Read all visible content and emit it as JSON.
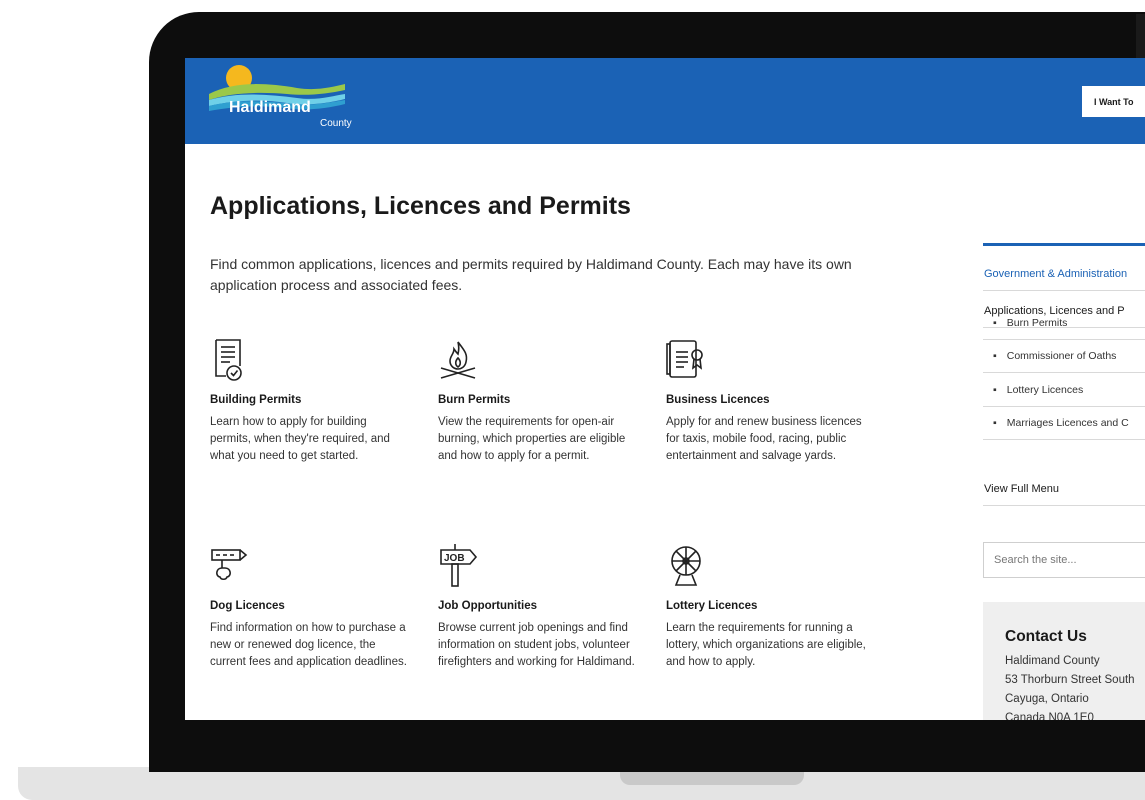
{
  "site": {
    "name": "Haldimand",
    "sub": "County",
    "header_button": "I Want To"
  },
  "page": {
    "title": "Applications, Licences and Permits",
    "intro": "Find common applications, licences and permits required by Haldimand County. Each may have its own application process and associated fees."
  },
  "cards": [
    {
      "icon": "document-certificate-icon",
      "title": "Building Permits",
      "desc": "Learn how to apply for building permits, when they're required, and what you need to get started."
    },
    {
      "icon": "campfire-icon",
      "title": "Burn Permits",
      "desc": "View the requirements for open-air burning, which properties are eligible and how to apply for a permit."
    },
    {
      "icon": "licence-document-icon",
      "title": "Business Licences",
      "desc": "Apply for and renew business licences for taxis, mobile food, racing, public entertainment and salvage yards."
    },
    {
      "icon": "dog-tag-icon",
      "title": "Dog Licences",
      "desc": "Find information on how to purchase a new or renewed dog licence, the current fees and application deadlines."
    },
    {
      "icon": "job-sign-icon",
      "title": "Job Opportunities",
      "desc": "Browse current job openings and find information on student jobs, volunteer firefighters and working for Haldimand."
    },
    {
      "icon": "lottery-wheel-icon",
      "title": "Lottery Licences",
      "desc": "Learn the requirements for running a lottery, which organizations are eligible, and how to apply."
    }
  ],
  "sidebar": {
    "parent": "Government & Administration",
    "current": "Applications, Licences and P",
    "items": [
      "Burn Permits",
      "Commissioner of Oaths",
      "Lottery Licences",
      "Marriages Licences and C"
    ],
    "full_menu": "View Full Menu",
    "search_placeholder": "Search the site..."
  },
  "contact": {
    "title": "Contact Us",
    "lines": [
      "Haldimand County",
      "53 Thorburn Street South",
      "Cayuga, Ontario",
      "Canada N0A 1E0"
    ]
  },
  "colors": {
    "brand_blue": "#1b62b5",
    "header_text": "#ffffff"
  }
}
